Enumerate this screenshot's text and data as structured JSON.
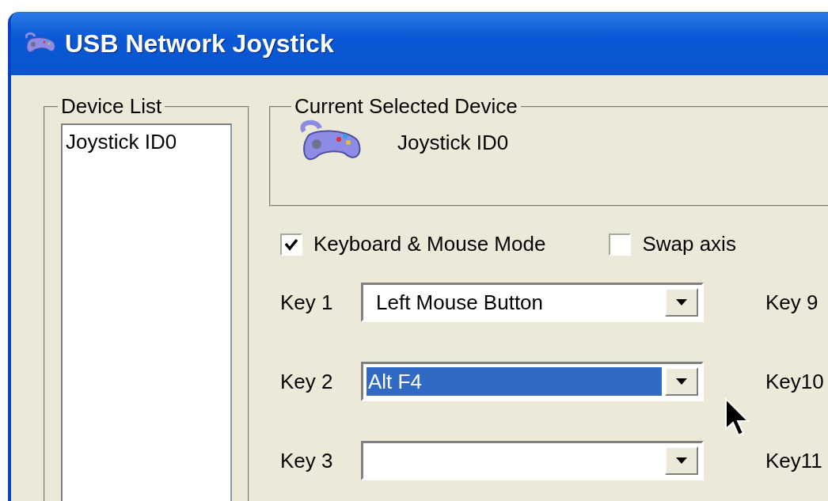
{
  "window": {
    "title": "USB Network Joystick"
  },
  "device_list": {
    "label": "Device List",
    "items": [
      {
        "label": "Joystick ID0",
        "selected": false
      }
    ]
  },
  "current_device": {
    "label": "Current Selected Device",
    "name": "Joystick ID0"
  },
  "options": [
    {
      "label": "Keyboard & Mouse Mode",
      "checked": true
    },
    {
      "label": "Swap axis",
      "checked": false
    }
  ],
  "keys": [
    {
      "label": "Key 1",
      "value": "Left Mouse Button",
      "selected": false,
      "side_label": "Key 9"
    },
    {
      "label": "Key 2",
      "value": "Alt F4",
      "selected": true,
      "side_label": "Key10"
    },
    {
      "label": "Key 3",
      "selected": false,
      "side_label": "Key11"
    }
  ]
}
